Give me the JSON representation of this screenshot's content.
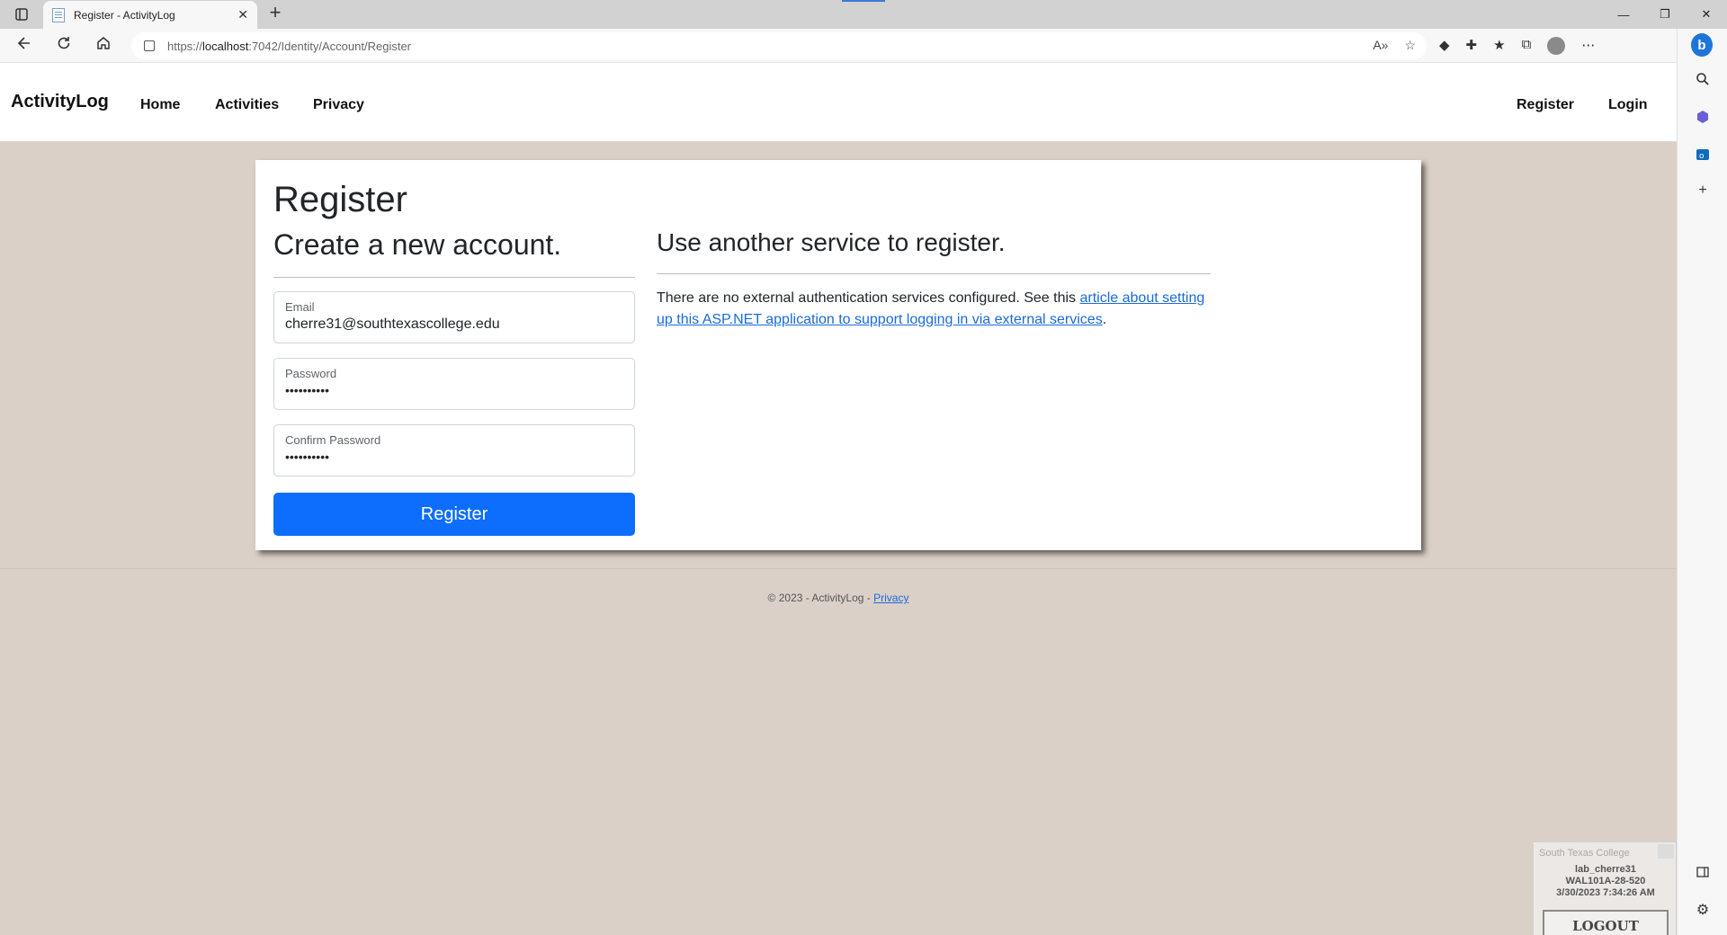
{
  "browser": {
    "tab_title": "Register - ActivityLog",
    "tab_close": "✕",
    "new_tab": "+",
    "url_prefix": "https://",
    "url_host": "localhost",
    "url_rest": ":7042/Identity/Account/Register",
    "window_controls": [
      "—",
      "❐",
      "✕"
    ]
  },
  "navbar": {
    "brand": "ActivityLog",
    "links": [
      "Home",
      "Activities",
      "Privacy"
    ],
    "right_links": [
      "Register",
      "Login"
    ]
  },
  "register": {
    "title": "Register",
    "subtitle": "Create a new account.",
    "email_label": "Email",
    "email_value": "cherre31@southtexascollege.edu",
    "password_label": "Password",
    "password_value": "••••••••••",
    "confirm_label": "Confirm Password",
    "confirm_value": "••••••••••",
    "button_label": "Register"
  },
  "external": {
    "title": "Use another service to register.",
    "text_before": "There are no external authentication services configured. See this ",
    "link_text": "article about setting up this ASP.NET application to support logging in via external services",
    "text_after": "."
  },
  "footer": {
    "text": "© 2023 - ActivityLog - ",
    "privacy_link": "Privacy"
  },
  "lab_widget": {
    "header": "South Texas College",
    "user": "lab_cherre31",
    "machine": "WAL101A-28-520",
    "datetime": "3/30/2023 7:34:26 AM",
    "logout": "LOGOUT"
  },
  "colors": {
    "page_bg": "#dbd0c8",
    "primary_button": "#0d6efd",
    "link": "#1a6bd8"
  }
}
